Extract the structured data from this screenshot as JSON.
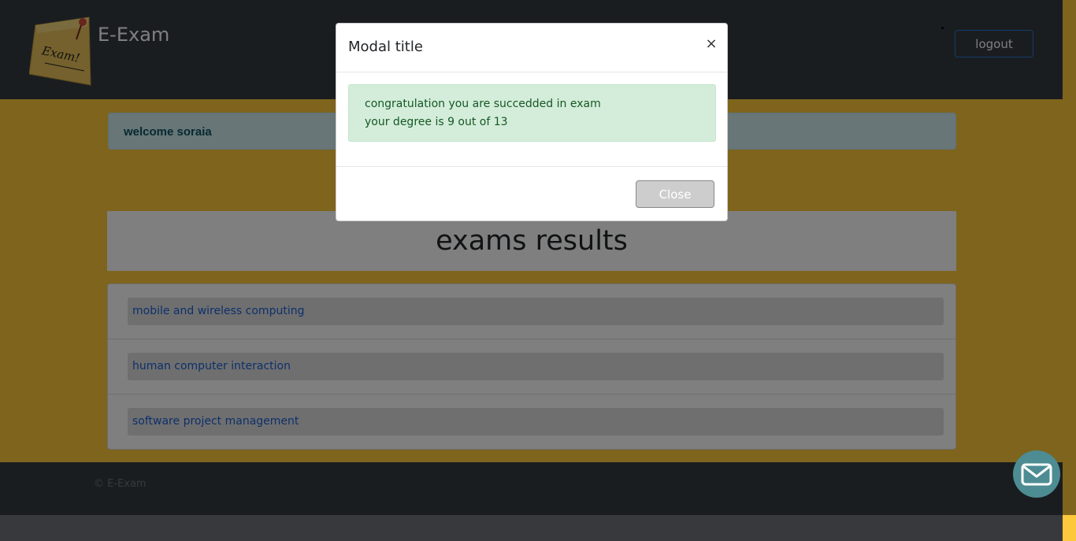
{
  "navbar": {
    "brand": "E-Exam",
    "logo_text": "Exam!",
    "logout_label": "logout"
  },
  "welcome": {
    "text": "welcome soraia"
  },
  "results": {
    "title": "exams results",
    "exams": [
      {
        "name": "mobile and wireless computing"
      },
      {
        "name": "human computer interaction"
      },
      {
        "name": "software project management"
      }
    ]
  },
  "footer": {
    "copyright": "© E-Exam"
  },
  "modal": {
    "title": "Modal title",
    "close_x": "×",
    "message_line1": "congratulation you are succedded in exam",
    "message_line2": "your degree is 9 out of 13",
    "close_label": "Close"
  },
  "icons": {
    "logo": "sticky-note-icon",
    "chat": "envelope-icon"
  },
  "colors": {
    "background": "#fdc83b",
    "navbar": "#343a40",
    "success_bg": "#d4edda",
    "success_text": "#155724",
    "link": "#1a60d6",
    "chat_button": "#4d8c93"
  }
}
